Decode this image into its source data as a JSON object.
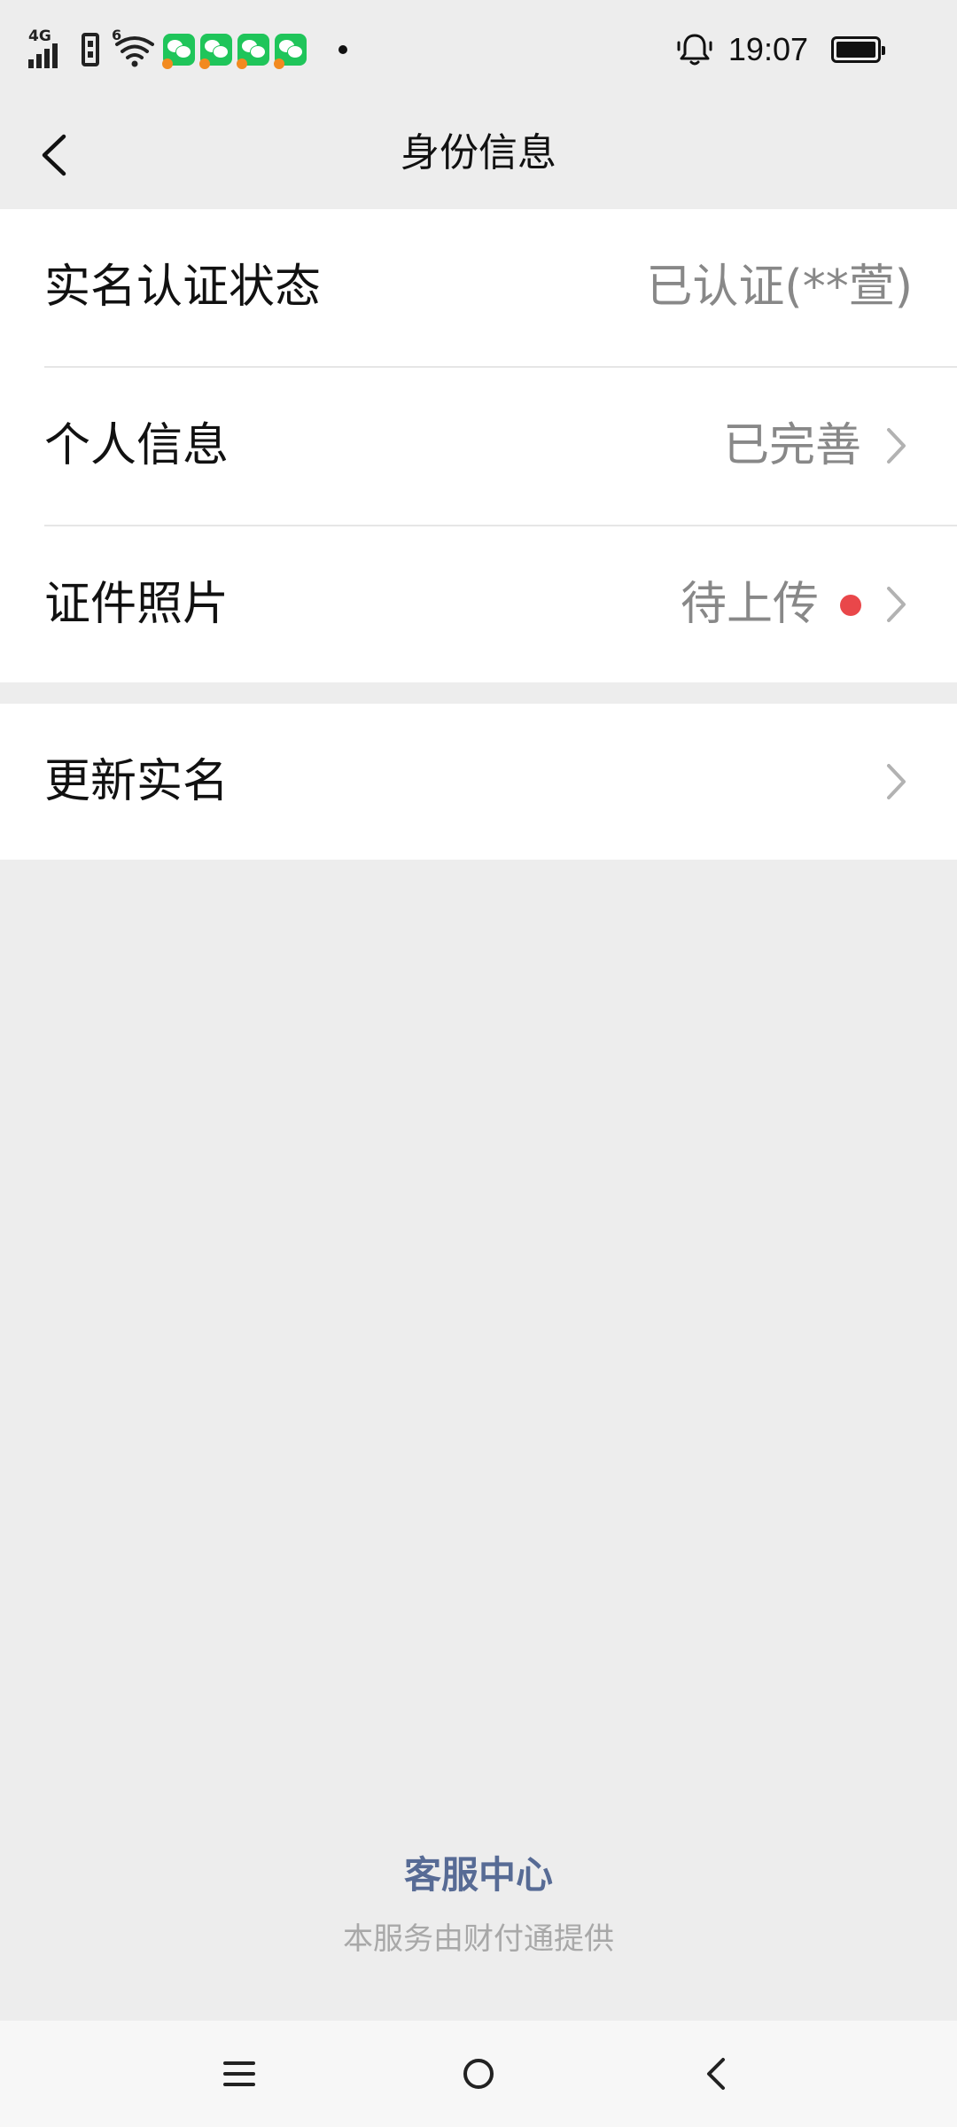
{
  "status_bar": {
    "network_label": "4G",
    "wifi_label": "6",
    "time": "19:07",
    "notification_icons": [
      "wechat-icon",
      "wechat-icon",
      "wechat-icon",
      "wechat-icon"
    ]
  },
  "header": {
    "title": "身份信息"
  },
  "identity_items": [
    {
      "label": "实名认证状态",
      "value": "已认证(**萱)"
    },
    {
      "label": "个人信息",
      "value": "已完善"
    },
    {
      "label": "证件照片",
      "value": "待上传"
    }
  ],
  "update_item": {
    "label": "更新实名"
  },
  "footer": {
    "service_center": "客服中心",
    "provider_note": "本服务由财付通提供"
  },
  "colors": {
    "background": "#ededed",
    "card": "#ffffff",
    "link": "#576b95",
    "alert_dot": "#e9474a",
    "secondary_text": "#888888"
  }
}
